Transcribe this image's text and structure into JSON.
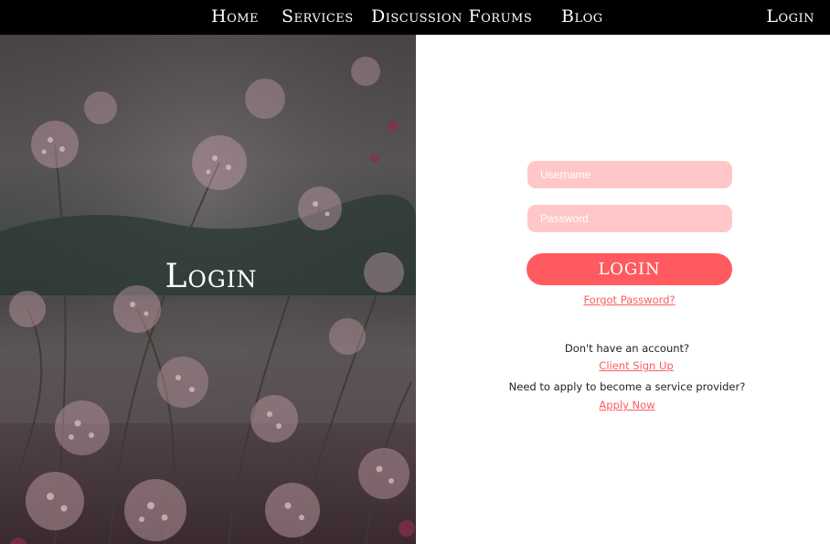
{
  "nav": {
    "home": "Home",
    "services": "Services",
    "forums": "Discussion Forums",
    "blog": "Blog",
    "login": "Login"
  },
  "hero": {
    "title": "Login",
    "image": "pink-wildflowers-photo"
  },
  "form": {
    "username_placeholder": "Username",
    "password_placeholder": "Password",
    "login_button": "LOGIN",
    "forgot_password": " Forgot Password?",
    "no_account_text": "Don't have an account?",
    "client_signup": "Client Sign Up",
    "provider_text": "Need to apply to become a service provider?",
    "apply_now": "Apply Now"
  },
  "colors": {
    "accent": "#ff5a5f",
    "input_bg": "#ffc7c7",
    "nav_bg": "#000000"
  }
}
